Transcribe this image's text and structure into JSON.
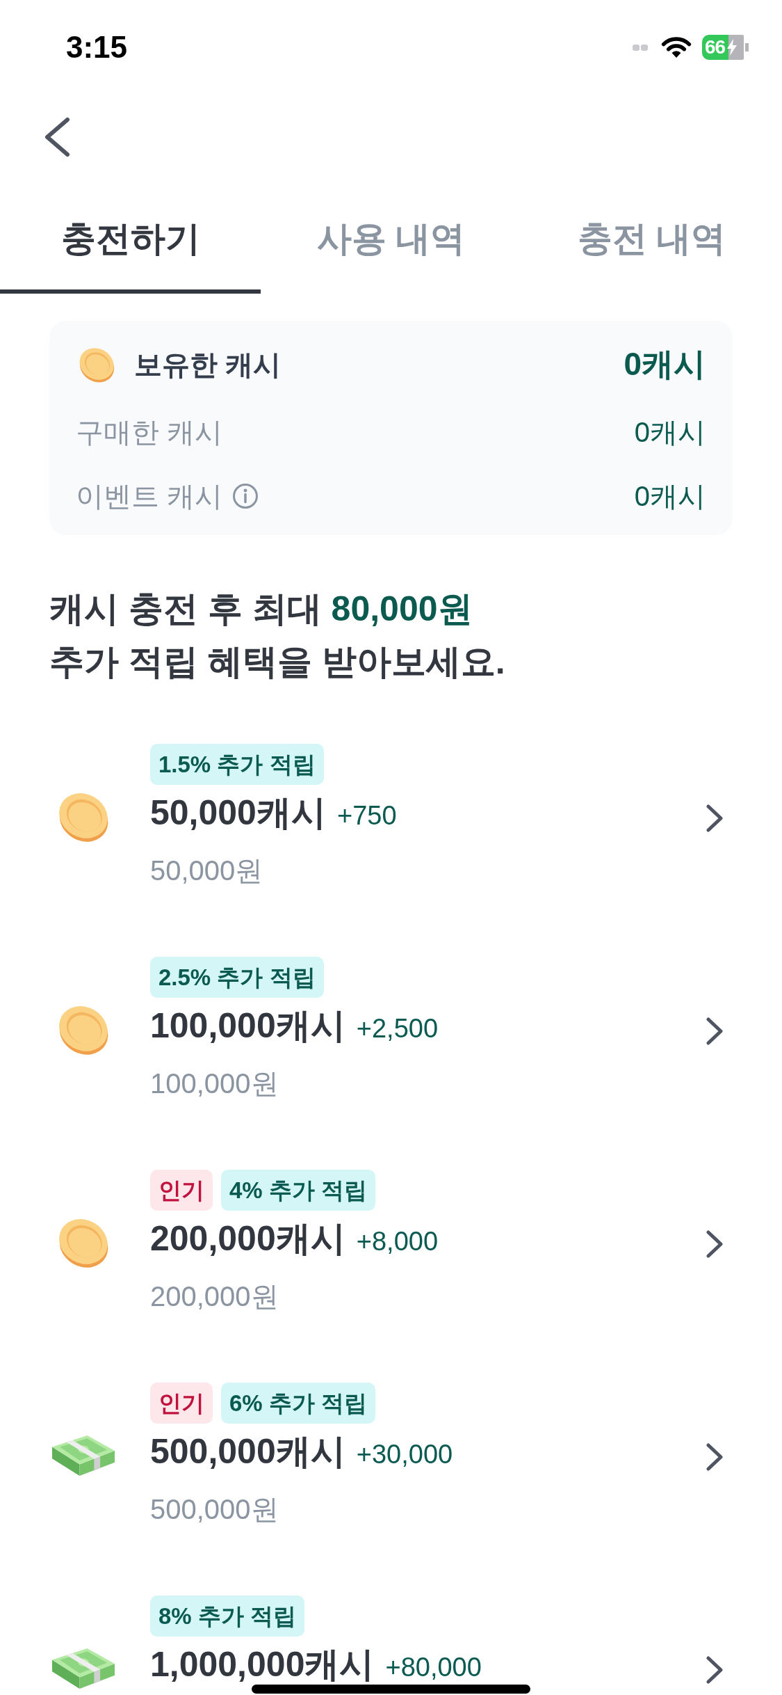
{
  "status_bar": {
    "time": "3:15",
    "battery": "66"
  },
  "tabs": [
    {
      "label": "충전하기",
      "selected": true
    },
    {
      "label": "사용 내역",
      "selected": false
    },
    {
      "label": "충전 내역",
      "selected": false
    }
  ],
  "balance": {
    "title": "보유한 캐시",
    "total": "0캐시",
    "rows": [
      {
        "label": "구매한 캐시",
        "value": "0캐시",
        "info": false
      },
      {
        "label": "이벤트 캐시",
        "value": "0캐시",
        "info": true
      }
    ]
  },
  "promo": {
    "text": "캐시 충전 후 최대 **80,000원**\n추가 적립 혜택을 받아보세요."
  },
  "packages": [
    {
      "kind": "coin",
      "badges": [
        {
          "kind": "bonus",
          "text": "1.5% 추가 적립"
        }
      ],
      "amount": "50,000캐시",
      "bonus": "+750",
      "price": "50,000원"
    },
    {
      "kind": "coin",
      "badges": [
        {
          "kind": "bonus",
          "text": "2.5% 추가 적립"
        }
      ],
      "amount": "100,000캐시",
      "bonus": "+2,500",
      "price": "100,000원"
    },
    {
      "kind": "coin",
      "badges": [
        {
          "kind": "popular",
          "text": "인기"
        },
        {
          "kind": "bonus",
          "text": "4% 추가 적립"
        }
      ],
      "amount": "200,000캐시",
      "bonus": "+8,000",
      "price": "200,000원"
    },
    {
      "kind": "cash",
      "badges": [
        {
          "kind": "popular",
          "text": "인기"
        },
        {
          "kind": "bonus",
          "text": "6% 추가 적립"
        }
      ],
      "amount": "500,000캐시",
      "bonus": "+30,000",
      "price": "500,000원"
    },
    {
      "kind": "cash",
      "badges": [
        {
          "kind": "bonus",
          "text": "8% 추가 적립"
        }
      ],
      "amount": "1,000,000캐시",
      "bonus": "+80,000"
    }
  ]
}
